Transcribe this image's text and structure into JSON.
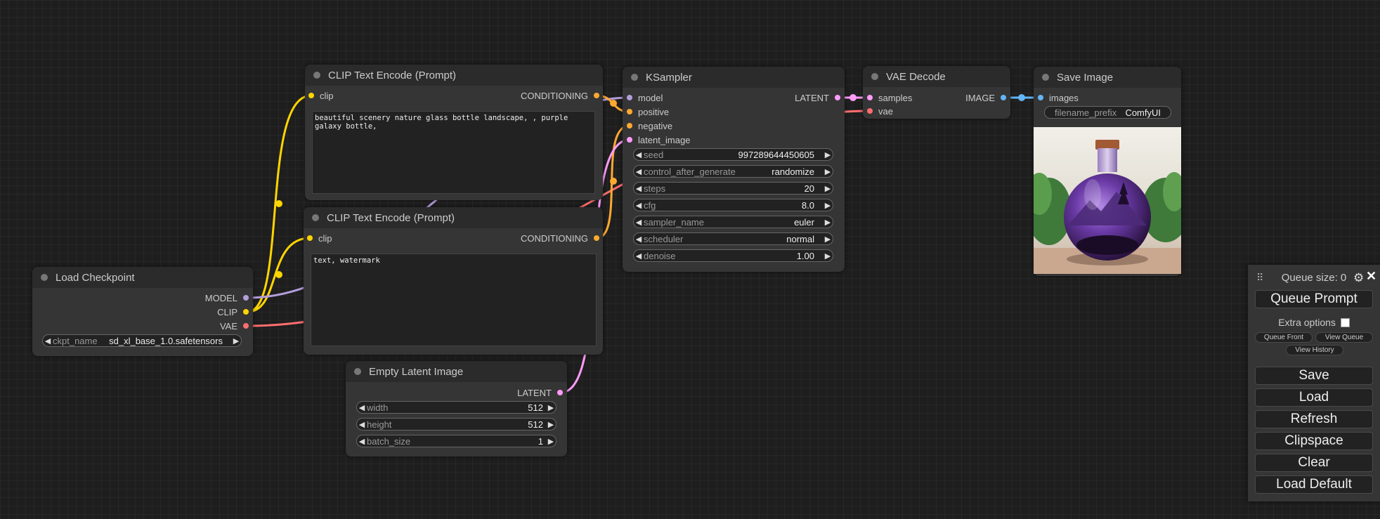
{
  "colors": {
    "clip": "#ffd500",
    "conditioning": "#ffa931",
    "model": "#b39ddb",
    "vae": "#ff6e6e",
    "latent": "#ff9cf9",
    "image": "#64b5f6"
  },
  "load_checkpoint": {
    "title": "Load Checkpoint",
    "outputs": [
      "MODEL",
      "CLIP",
      "VAE"
    ],
    "ckpt_label": "ckpt_name",
    "ckpt_value": "sd_xl_base_1.0.safetensors"
  },
  "clip_pos": {
    "title": "CLIP Text Encode (Prompt)",
    "input": "clip",
    "output": "CONDITIONING",
    "text": "beautiful scenery nature glass bottle landscape, , purple galaxy bottle,"
  },
  "clip_neg": {
    "title": "CLIP Text Encode (Prompt)",
    "input": "clip",
    "output": "CONDITIONING",
    "text": "text, watermark"
  },
  "empty_latent": {
    "title": "Empty Latent Image",
    "output": "LATENT",
    "width_label": "width",
    "width_value": "512",
    "height_label": "height",
    "height_value": "512",
    "batch_label": "batch_size",
    "batch_value": "1"
  },
  "ksampler": {
    "title": "KSampler",
    "inputs": [
      "model",
      "positive",
      "negative",
      "latent_image"
    ],
    "output": "LATENT",
    "widgets": [
      {
        "label": "seed",
        "value": "997289644450605"
      },
      {
        "label": "control_after_generate",
        "value": "randomize"
      },
      {
        "label": "steps",
        "value": "20"
      },
      {
        "label": "cfg",
        "value": "8.0"
      },
      {
        "label": "sampler_name",
        "value": "euler"
      },
      {
        "label": "scheduler",
        "value": "normal"
      },
      {
        "label": "denoise",
        "value": "1.00"
      }
    ]
  },
  "vae_decode": {
    "title": "VAE Decode",
    "inputs": [
      "samples",
      "vae"
    ],
    "output": "IMAGE"
  },
  "save_image": {
    "title": "Save Image",
    "input": "images",
    "prefix_label": "filename_prefix",
    "prefix_value": "ComfyUI"
  },
  "menu": {
    "queue_size": "Queue size: 0",
    "queue_prompt": "Queue Prompt",
    "extra_options": "Extra options",
    "queue_front": "Queue Front",
    "view_queue": "View Queue",
    "view_history": "View History",
    "save": "Save",
    "load": "Load",
    "refresh": "Refresh",
    "clipspace": "Clipspace",
    "clear": "Clear",
    "load_default": "Load Default"
  }
}
